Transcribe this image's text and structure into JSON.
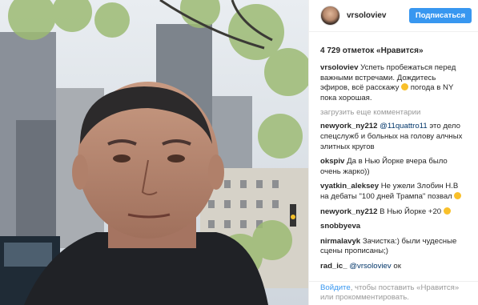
{
  "post": {
    "username": "vrsoloviev",
    "follow_label": "Подписаться",
    "likes": "4 729 отметок «Нравится»"
  },
  "caption": {
    "user": "vrsoloviev",
    "text_a": "Успеть пробежаться перед важными встречами. Дождитесь эфиров, всё расскажу",
    "text_b": "погода в NY пока хорошая."
  },
  "more_comments": "загрузить еще комментарии",
  "comments": [
    {
      "user": "newyork_ny212",
      "mention": "@11quattro11",
      "text": "это дело спецслужб и больных на голову алчных элитных кругов"
    },
    {
      "user": "okspiv",
      "mention": "",
      "text": "Да в Нью Йорке вчера было очень жарко))"
    },
    {
      "user": "vyatkin_aleksey",
      "mention": "",
      "text": "Не ужели Злобин Н.В на дебаты \"100 дней Трампа\" позвал"
    },
    {
      "user": "newyork_ny212",
      "mention": "",
      "text": "В Нью Йорке +20"
    },
    {
      "user": "snobbyeva",
      "mention": "",
      "text": ""
    },
    {
      "user": "nirmalavyk",
      "mention": "",
      "text": "Зачистка:) были чудесные сцены прописаны;)"
    },
    {
      "user": "rad_ic_",
      "mention": "@vrsoloviev",
      "text": "ок"
    }
  ],
  "footer": {
    "login_link": "Войдите",
    "text": ", чтобы поставить «Нравится» или прокомментировать."
  }
}
